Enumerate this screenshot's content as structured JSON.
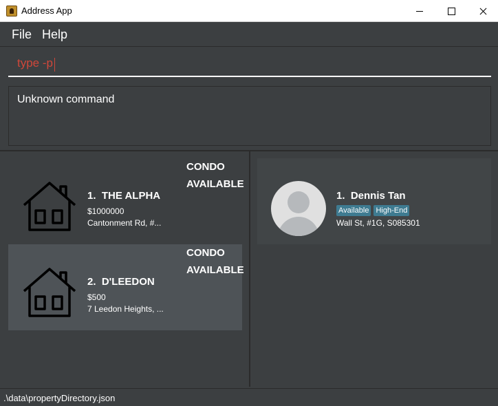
{
  "window": {
    "title": "Address App"
  },
  "menu": {
    "file": "File",
    "help": "Help"
  },
  "command": {
    "value": "type -p"
  },
  "result": {
    "text": "Unknown command"
  },
  "properties": [
    {
      "name": "1.  THE ALPHA",
      "price": "$1000000",
      "address": "Cantonment Rd, #...",
      "type": "CONDO",
      "status": "AVAILABLE",
      "icon": "house-icon"
    },
    {
      "name": "2.  D'LEEDON",
      "price": "$500",
      "address": "7 Leedon Heights, ...",
      "type": "CONDO",
      "status": "AVAILABLE",
      "icon": "house-icon"
    }
  ],
  "persons": [
    {
      "name": "1.  Dennis Tan",
      "tags": [
        "Available",
        "High-End"
      ],
      "address": "Wall St, #1G, S085301",
      "icon": "avatar-placeholder-icon"
    }
  ],
  "status_bar": {
    "path": ".\\data\\propertyDirectory.json"
  },
  "colors": {
    "background": "#3c3f41",
    "selected_card": "#4e5357",
    "tag": "#3e7b91",
    "command_text": "#d0473a"
  }
}
